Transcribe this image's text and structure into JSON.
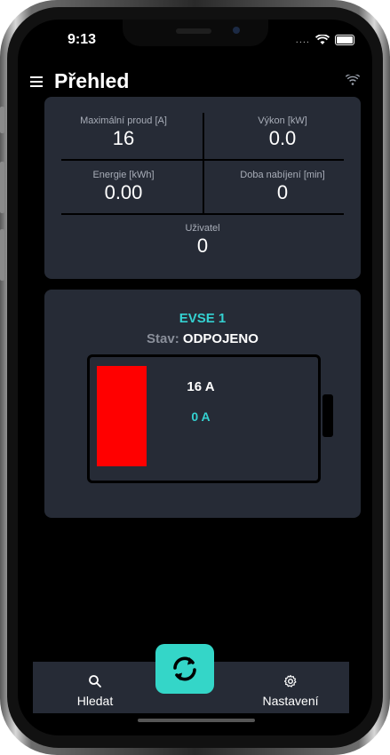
{
  "status_bar": {
    "time": "9:13",
    "signal_dots": "...."
  },
  "header": {
    "title": "Přehled"
  },
  "overview": {
    "max_current": {
      "label": "Maximální proud [A]",
      "value": "16"
    },
    "power": {
      "label": "Výkon [kW]",
      "value": "0.0"
    },
    "energy": {
      "label": "Energie [kWh]",
      "value": "0.00"
    },
    "charge_time": {
      "label": "Doba nabíjení [min]",
      "value": "0"
    },
    "user": {
      "label": "Uživatel",
      "value": "0"
    }
  },
  "evse": {
    "name": "EVSE 1",
    "state_label": "Stav:",
    "state_value": "ODPOJENO",
    "max_amps": "16 A",
    "current_amps": "0 A",
    "fill_color": "#ff0000",
    "accent_color": "#34d1d1"
  },
  "tabbar": {
    "search": {
      "label": "Hledat",
      "icon": "search-icon"
    },
    "refresh": {
      "icon": "refresh-icon"
    },
    "settings": {
      "label": "Nastavení",
      "icon": "gear-icon"
    }
  }
}
